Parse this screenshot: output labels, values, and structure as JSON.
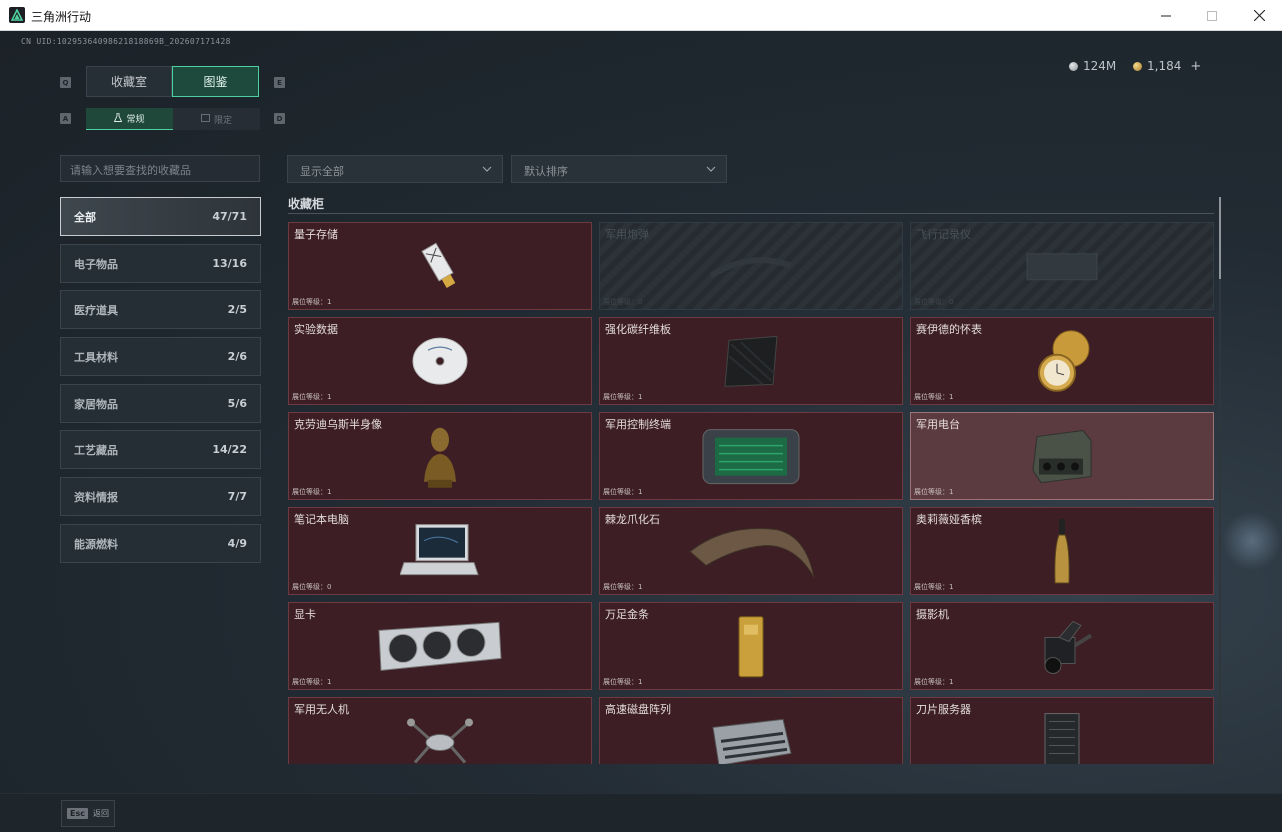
{
  "window": {
    "title": "三角洲行动",
    "controls": [
      "minimize",
      "maximize",
      "close"
    ]
  },
  "uid": "CN UID:10295364098621818869B_202607171428",
  "hotkeys": {
    "prev_tab": "Q",
    "next_tab": "E",
    "prev_sub": "A",
    "next_sub": "D"
  },
  "tabs": [
    {
      "label": "收藏室",
      "active": false
    },
    {
      "label": "图鉴",
      "active": true
    }
  ],
  "subtabs": [
    {
      "label": "常规",
      "active": true
    },
    {
      "label": "限定",
      "active": false
    }
  ],
  "currency": {
    "silver": "124M",
    "gold": "1,184",
    "add_label": "+",
    "colors": {
      "silver": "#c7cbce",
      "gold": "#d9b45f"
    }
  },
  "search": {
    "placeholder": "请输入想要查找的收藏品"
  },
  "filters": {
    "display": {
      "value": "显示全部"
    },
    "sort": {
      "value": "默认排序"
    }
  },
  "categories": [
    {
      "label": "全部",
      "count": "47/71",
      "active": true
    },
    {
      "label": "电子物品",
      "count": "13/16"
    },
    {
      "label": "医疗道具",
      "count": "2/5"
    },
    {
      "label": "工具材料",
      "count": "2/6"
    },
    {
      "label": "家居物品",
      "count": "5/6"
    },
    {
      "label": "工艺藏品",
      "count": "14/22"
    },
    {
      "label": "资料情报",
      "count": "7/7"
    },
    {
      "label": "能源燃料",
      "count": "4/9"
    }
  ],
  "section": {
    "title": "收藏柜"
  },
  "items": [
    {
      "name": "量子存储",
      "level": "展位等级：1",
      "locked": false,
      "icon": "usb-drive-icon"
    },
    {
      "name": "军用炮弹",
      "level": "展位等级：0",
      "locked": true,
      "icon": "artillery-shell-icon"
    },
    {
      "name": "飞行记录仪",
      "level": "展位等级：0",
      "locked": true,
      "icon": "flight-recorder-icon"
    },
    {
      "name": "实验数据",
      "level": "展位等级：1",
      "locked": false,
      "icon": "disc-icon"
    },
    {
      "name": "强化碳纤维板",
      "level": "展位等级：1",
      "locked": false,
      "icon": "carbon-plate-icon"
    },
    {
      "name": "赛伊德的怀表",
      "level": "展位等级：1",
      "locked": false,
      "icon": "pocket-watch-icon"
    },
    {
      "name": "克劳迪乌斯半身像",
      "level": "展位等级：1",
      "locked": false,
      "icon": "bust-statue-icon"
    },
    {
      "name": "军用控制终端",
      "level": "展位等级：1",
      "locked": false,
      "icon": "control-terminal-icon"
    },
    {
      "name": "军用电台",
      "level": "展位等级：1",
      "locked": false,
      "highlight": true,
      "icon": "military-radio-icon"
    },
    {
      "name": "笔记本电脑",
      "level": "展位等级：0",
      "locked": false,
      "icon": "laptop-icon"
    },
    {
      "name": "棘龙爪化石",
      "level": "展位等级：1",
      "locked": false,
      "icon": "claw-fossil-icon"
    },
    {
      "name": "奥莉薇娅香槟",
      "level": "展位等级：1",
      "locked": false,
      "icon": "champagne-icon"
    },
    {
      "name": "显卡",
      "level": "展位等级：1",
      "locked": false,
      "icon": "graphics-card-icon"
    },
    {
      "name": "万足金条",
      "level": "展位等级：1",
      "locked": false,
      "icon": "gold-bar-icon"
    },
    {
      "name": "摄影机",
      "level": "展位等级：1",
      "locked": false,
      "icon": "camera-icon"
    },
    {
      "name": "军用无人机",
      "level": "",
      "locked": false,
      "icon": "drone-icon"
    },
    {
      "name": "高速磁盘阵列",
      "level": "",
      "locked": false,
      "icon": "disk-array-icon"
    },
    {
      "name": "刀片服务器",
      "level": "",
      "locked": false,
      "icon": "blade-server-icon"
    }
  ],
  "footer": {
    "esc_key": "Esc",
    "esc_label": "返回"
  },
  "colors": {
    "accent": "#4fd0a0",
    "card_bg": "#3c1e24",
    "card_border": "#6d3a42",
    "bg": "#1e252c"
  }
}
